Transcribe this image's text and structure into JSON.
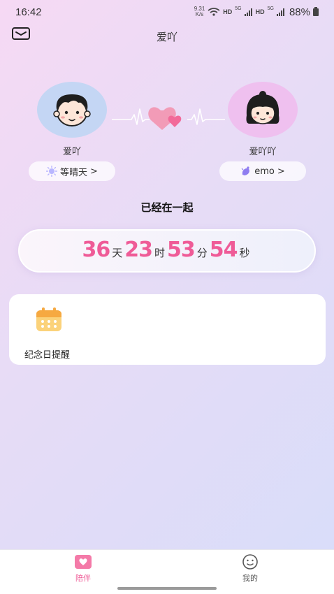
{
  "status_bar": {
    "time": "16:42",
    "net_speed_value": "9.31",
    "net_speed_unit": "K/s",
    "hd1": "HD",
    "sig1": "5G",
    "hd2": "HD",
    "sig2": "5G",
    "battery": "88%"
  },
  "header": {
    "title": "爱吖"
  },
  "couple": {
    "left_name": "爱吖",
    "right_name": "爱吖吖",
    "left_mood": "等晴天",
    "right_mood": "emo",
    "chevron": ">"
  },
  "together": {
    "label": "已经在一起",
    "days": "36",
    "days_unit": "天",
    "hours": "23",
    "hours_unit": "时",
    "minutes": "53",
    "minutes_unit": "分",
    "seconds": "54",
    "seconds_unit": "秒"
  },
  "card": {
    "item_label": "纪念日提醒"
  },
  "tabs": [
    {
      "label": "陪伴",
      "icon": "heart-tab-icon"
    },
    {
      "label": "我的",
      "icon": "smiley-tab-icon"
    }
  ],
  "colors": {
    "accent": "#ef5b97",
    "bg_start": "#f6d9f4",
    "bg_end": "#d8ddfa"
  }
}
